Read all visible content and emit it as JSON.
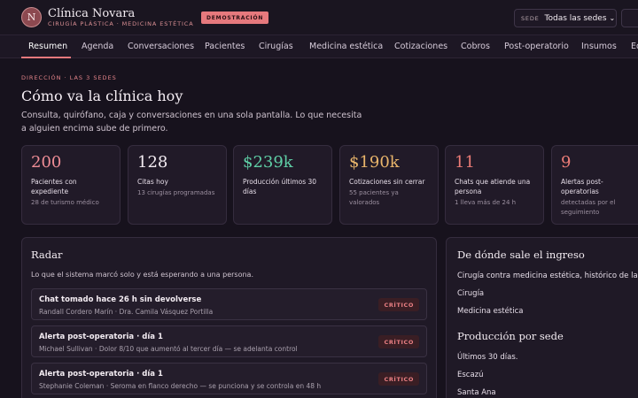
{
  "header": {
    "logo_letter": "N",
    "brand_name": "Clínica Novara",
    "brand_sub": "CIRUGÍA PLÁSTICA · MEDICINA ESTÉTICA",
    "demo_badge": "DEMOSTRACIÓN",
    "sede_label": "SEDE",
    "sede_value": "Todas las sedes"
  },
  "nav": {
    "active": "Resumen",
    "items": [
      "Resumen",
      "Agenda",
      "Conversaciones",
      "Pacientes",
      "Cirugías",
      "Medicina estética",
      "Cotizaciones",
      "Cobros",
      "Post-operatorio",
      "Insumos",
      "Eq"
    ]
  },
  "hero": {
    "eyebrow": "DIRECCIÓN · LAS 3 SEDES",
    "title": "Cómo va la clínica hoy",
    "subtitle": "Consulta, quirófano, caja y conversaciones en una sola pantalla. Lo que necesita a alguien encima sube de primero."
  },
  "kpis": [
    {
      "value": "200",
      "label": "Pacientes con expediente",
      "note": "28 de turismo médico",
      "color": "#ef8d96"
    },
    {
      "value": "128",
      "label": "Citas hoy",
      "note": "13 cirugías programadas",
      "color": "#f3ecf2"
    },
    {
      "value": "$239k",
      "label": "Producción últimos 30 días",
      "note": "",
      "color": "#5fcfa6"
    },
    {
      "value": "$190k",
      "label": "Cotizaciones sin cerrar",
      "note": "55 pacientes ya valorados",
      "color": "#e9b56b"
    },
    {
      "value": "11",
      "label": "Chats que atiende una persona",
      "note": "1 lleva más de 24 h",
      "color": "#ec7c77"
    },
    {
      "value": "9",
      "label": "Alertas post-operatorias",
      "note": "detectadas por el seguimiento",
      "color": "#ec7c77"
    }
  ],
  "radar": {
    "title": "Radar",
    "subtitle": "Lo que el sistema marcó solo y está esperando a una persona.",
    "alerts": [
      {
        "title": "Chat tomado hace 26 h sin devolverse",
        "detail": "Randall Cordero Marín · Dra. Camila Vásquez Portilla",
        "badge": "CRÍTICO"
      },
      {
        "title": "Alerta post-operatoria · día 1",
        "detail": "Michael Sullivan · Dolor 8/10 que aumentó al tercer día — se adelanta control",
        "badge": "CRÍTICO"
      },
      {
        "title": "Alerta post-operatoria · día 1",
        "detail": "Stephanie Coleman · Seroma en flanco derecho — se punciona y se controla en 48 h",
        "badge": "CRÍTICO"
      }
    ]
  },
  "income": {
    "title": "De dónde sale el ingreso",
    "subtitle": "Cirugía contra medicina estética, histórico de la base",
    "lines": [
      "Cirugía",
      "Medicina estética"
    ]
  },
  "production": {
    "title": "Producción por sede",
    "subtitle": "Últimos 30 días.",
    "lines": [
      "Escazú",
      "Santa Ana"
    ]
  },
  "colors": {
    "accent": "#e6797d",
    "background": "#17121d",
    "card": "#211a28"
  }
}
